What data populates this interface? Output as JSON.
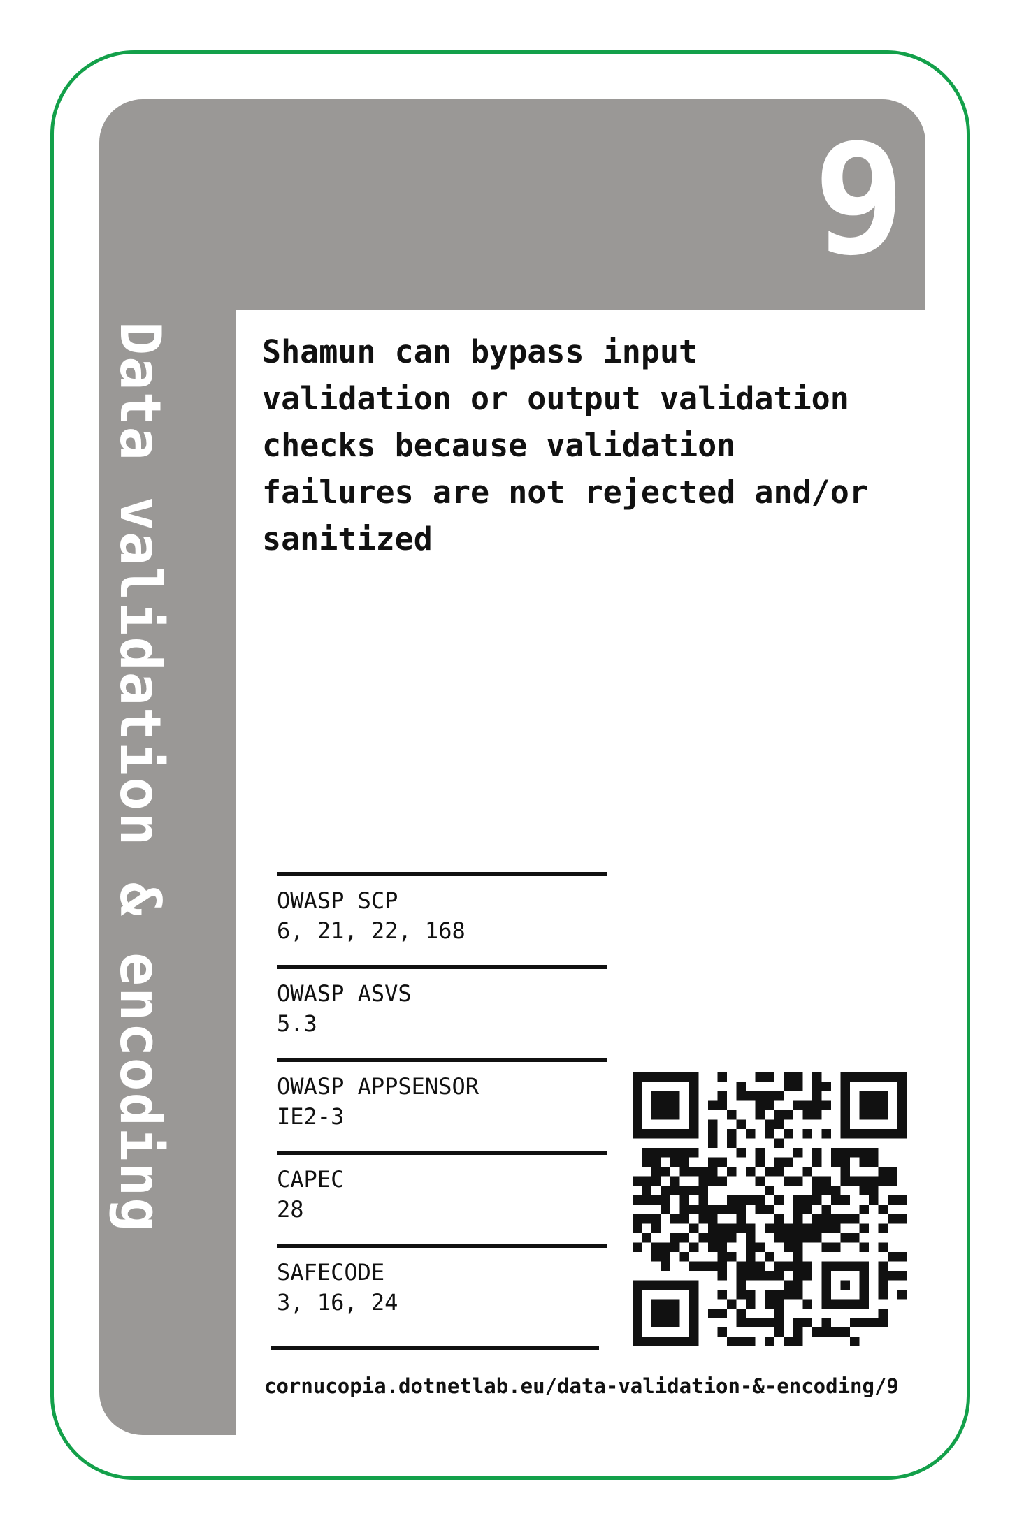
{
  "card": {
    "number": "9",
    "suit": "Data validation & encoding",
    "description": "Shamun can bypass input validation or output validation checks because validation failures are not rejected and/or sanitized",
    "url": "cornucopia.dotnetlab.eu/data-validation-&-encoding/9"
  },
  "references": [
    {
      "name": "OWASP SCP",
      "values": "6, 21, 22, 168"
    },
    {
      "name": "OWASP ASVS",
      "values": "5.3"
    },
    {
      "name": "OWASP APPSENSOR",
      "values": "IE2-3"
    },
    {
      "name": "CAPEC",
      "values": "28"
    },
    {
      "name": "SAFECODE",
      "values": "3, 16, 24"
    }
  ],
  "colors": {
    "border": "#13a04a",
    "panel": "#9a9896",
    "text": "#111111"
  },
  "icons": {
    "qr_code": "qr-code-icon"
  }
}
